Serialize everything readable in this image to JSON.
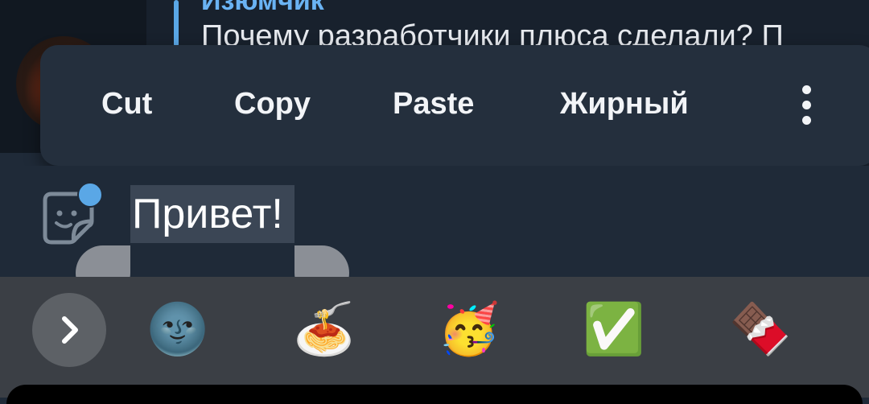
{
  "reply": {
    "author": "Изюмчик",
    "text": "Почему разработчики плюса сделали? П"
  },
  "context_menu": {
    "items": [
      "Cut",
      "Copy",
      "Paste",
      "Жирный"
    ],
    "more_icon": "more-vertical-icon"
  },
  "input": {
    "text": "Привет!",
    "selected_text": "Привет!",
    "sticker_icon": "sticker-icon",
    "notification_dot_color": "#5aa7e6"
  },
  "emoji_suggestions": {
    "expand_icon": "chevron-right-icon",
    "items": [
      "🌚",
      "🍝",
      "🥳",
      "✅",
      "🍫"
    ]
  },
  "colors": {
    "accent": "#5aa7e6",
    "menu_bg": "#242f3d",
    "input_bg": "#1f2a38",
    "emoji_bar_bg": "#3b3f45"
  }
}
